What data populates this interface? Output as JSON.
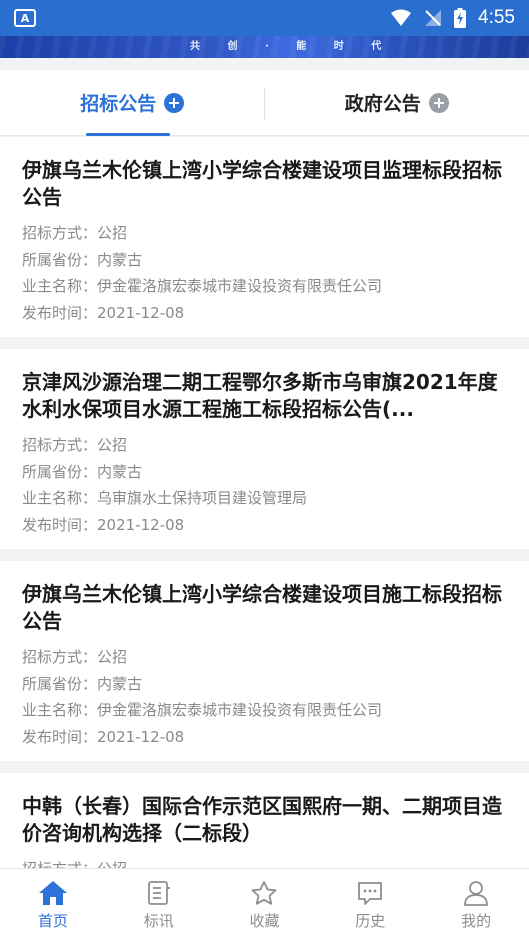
{
  "status_bar": {
    "app_badge": "A",
    "time": "4:55"
  },
  "banner": {
    "text": "共 创 · 能 时 代"
  },
  "tabs": [
    {
      "label": "招标公告",
      "active": true
    },
    {
      "label": "政府公告",
      "active": false
    }
  ],
  "field_labels": {
    "method": "招标方式：",
    "province": "所属省份：",
    "owner": "业主名称：",
    "date": "发布时间："
  },
  "items": [
    {
      "title": "伊旗乌兰木伦镇上湾小学综合楼建设项目监理标段招标公告",
      "method": "公招",
      "province": "内蒙古",
      "owner": "伊金霍洛旗宏泰城市建设投资有限责任公司",
      "date": "2021-12-08"
    },
    {
      "title": "京津风沙源治理二期工程鄂尔多斯市乌审旗2021年度水利水保项目水源工程施工标段招标公告(...",
      "method": "公招",
      "province": "内蒙古",
      "owner": "乌审旗水土保持项目建设管理局",
      "date": "2021-12-08"
    },
    {
      "title": "伊旗乌兰木伦镇上湾小学综合楼建设项目施工标段招标公告",
      "method": "公招",
      "province": "内蒙古",
      "owner": "伊金霍洛旗宏泰城市建设投资有限责任公司",
      "date": "2021-12-08"
    },
    {
      "title": "中韩（长春）国际合作示范区国熙府一期、二期项目造价咨询机构选择（二标段）",
      "method": "公招",
      "province": "",
      "owner": "",
      "date": ""
    }
  ],
  "bottom_nav": [
    {
      "label": "首页",
      "icon": "home-icon",
      "active": true
    },
    {
      "label": "标讯",
      "icon": "document-icon",
      "active": false
    },
    {
      "label": "收藏",
      "icon": "star-icon",
      "active": false
    },
    {
      "label": "历史",
      "icon": "chat-icon",
      "active": false
    },
    {
      "label": "我的",
      "icon": "user-icon",
      "active": false
    }
  ],
  "colors": {
    "accent": "#2d72d9",
    "status_bar": "#2a6fcf",
    "muted_text": "#8a8a8a"
  }
}
